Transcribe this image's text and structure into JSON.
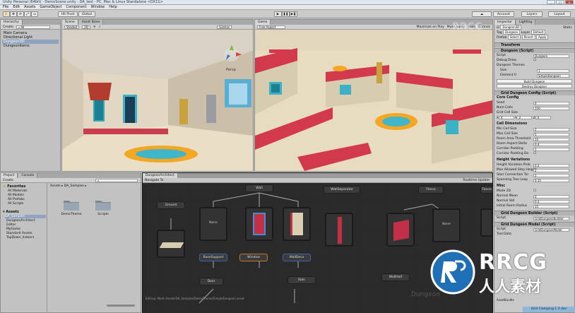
{
  "window": {
    "title": "Unity Personal (64bit) - DemoScene.unity - DA_test - PC, Mac & Linux Standalone <DX11>"
  },
  "menu": [
    "File",
    "Edit",
    "Assets",
    "GameObject",
    "Component",
    "Window",
    "Help"
  ],
  "toolbar": {
    "pivot": "Hit Pivot",
    "global": "Global",
    "account": "Account",
    "layers": "Layers",
    "layout": "Layout"
  },
  "hierarchy": {
    "tab": "Hierarchy",
    "create": "Create",
    "items": [
      "Main Camera",
      "Directional Light",
      "Dungeon3D",
      "DungeonItems"
    ]
  },
  "scene": {
    "tab": "Scene",
    "tab2": "Asset Store",
    "shaded": "Shaded",
    "mode2d": "2D",
    "gizmos": "Gizmos",
    "persp": "Persp"
  },
  "game": {
    "tab": "Game",
    "display": "Free Aspect",
    "maximize": "Maximize on Play",
    "mute": "Mute audio",
    "stats": "Stats",
    "gizmos": "Gizmos"
  },
  "project": {
    "tab": "Project",
    "tab2": "Console",
    "create": "Create",
    "favorites_title": "Favorites",
    "favorites": [
      "All Materials",
      "All Models",
      "All Prefabs",
      "All Scripts"
    ],
    "assets_title": "Assets",
    "assets": [
      "DA_Samples",
      "DungeonArchitect",
      "Editor",
      "MyGame",
      "Standard Assets",
      "TopDown_Indoors"
    ],
    "breadcrumb": "Assets ▸ DA_Samples ▸",
    "files": [
      "DemoTheme",
      "Scripts"
    ]
  },
  "graph": {
    "tab": "DungeonArchitect",
    "toolbar_btn": "Navigate To",
    "realtime": "Realtime Update",
    "status_path": "Editing: Mesh Assets/DA_Samples/DemoTheme/SimpleDungeon.asset",
    "watermark": "Dungeon",
    "nodes": {
      "wall": "Wall",
      "wall_separator": "WallSeparator",
      "fence": "Fence",
      "fence2": "Fence",
      "ground": "Ground",
      "none1": "None",
      "none2": "None",
      "base_support": "BaseSupport",
      "window": "Window",
      "wall_deco": "WallDeco",
      "door": "Door",
      "stair": "Stair",
      "wallhalf": "WallHalf"
    }
  },
  "inspector": {
    "tab": "Inspector",
    "tab2": "Lighting",
    "object_name": "Dungeon3D",
    "static": "Static",
    "tag_label": "Tag",
    "tag": "Dungeon",
    "layer_label": "Layer",
    "layer": "Default",
    "prefab_label": "Prefab",
    "prefab_select": "Select",
    "prefab_revert": "Revert",
    "prefab_apply": "Apply",
    "transform": "Transform",
    "dungeon_script": "Dungeon (Script)",
    "script_label": "Script",
    "script_val": "Dungeon",
    "debug_draw": "Debug Draw",
    "themes": "Dungeon Themes",
    "size_label": "Size",
    "size_val": "1",
    "element_label": "Element 0",
    "element_val": "SimpleDungeon",
    "build": "Build Dungeon",
    "destroy": "Destroy Dungeon",
    "grid_config": "Grid Dungeon Config (Script)",
    "core_config": "Core Config",
    "seed_label": "Seed",
    "seed_val": "0",
    "numcells_label": "Num Cells",
    "numcells_val": "150",
    "gridcell_label": "Grid Cell Size",
    "gx": "4",
    "gy": "2",
    "gz": "4",
    "cell_dims": "Cell Dimensions",
    "min_cell": "Min Cell Size",
    "min_cell_val": "2",
    "max_cell": "Max Cell Size",
    "max_cell_val": "5",
    "room_area": "Room Area Threshold",
    "room_area_val": "15",
    "room_aspect": "Room Aspect Delta",
    "room_aspect_val": "0.4",
    "corridor_pad": "Corridor Padding",
    "corridor_pad_val": "1",
    "corridor_double": "Corridor Padding Do",
    "height_var": "Height Variations",
    "height_prob": "Height Variation Prob",
    "height_prob_val": "0.2",
    "max_height": "Max Allowed Step Height",
    "max_height_val": "2",
    "stair_conn": "Stair Connection Tol",
    "stair_conn_val": "2",
    "spanning": "Spanning Tree Loop",
    "spanning_val": "0.15",
    "misc": "Misc",
    "mode2d": "Mode 2D",
    "normal_mean": "Normal Mean",
    "normal_mean_val": "0",
    "normal_std": "Normal Std",
    "normal_std_val": "0.3",
    "initial_room": "Initial Room Radius",
    "initial_room_val": "15",
    "grid_builder": "Grid Dungeon Builder (Script)",
    "gb_script": "GridDungeonBuilder",
    "grid_model": "Grid Dungeon Model (Script)",
    "gm_script": "GridDungeonModel",
    "tool_data": "Tool Data",
    "asset_bundle": "AssetBundle",
    "status": "Grid Clamping 1.3 dev"
  },
  "overlay": {
    "brand": "RRCG",
    "brand_cn": "人人素材",
    "watermark_bg": "RRCG"
  },
  "colors": {
    "panel": "#c2c2c2",
    "dark": "#2a2a2a",
    "floor": "#e8dcc0",
    "wall_red": "#d23a4c",
    "teal": "#41b6c9",
    "orange": "#f5a623",
    "sky": "#9bc4e2"
  }
}
